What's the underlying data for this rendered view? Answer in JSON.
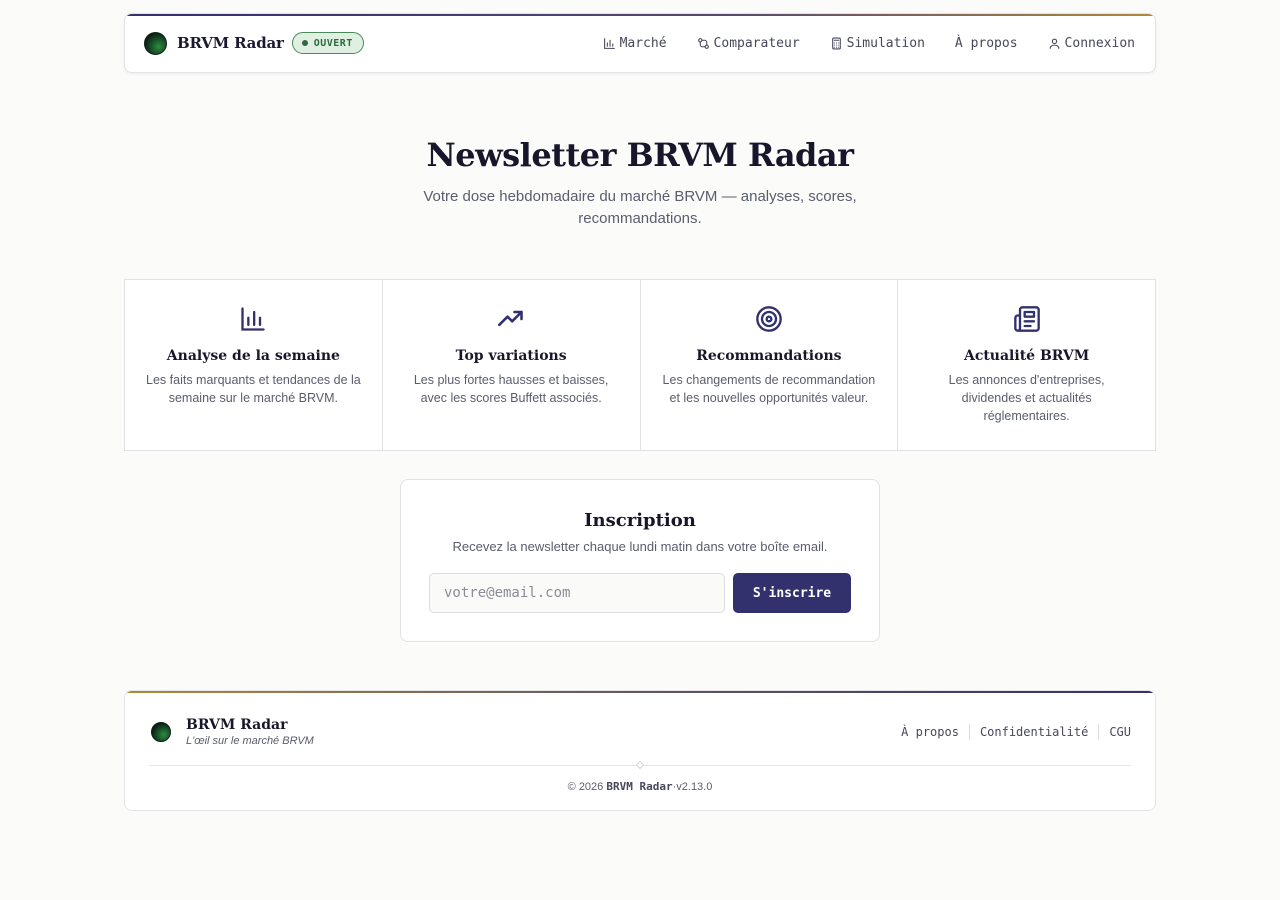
{
  "header": {
    "brand": "BRVM Radar",
    "status_badge": "OUVERT",
    "nav": {
      "market": "Marché",
      "compare": "Comparateur",
      "simulation": "Simulation",
      "about": "À propos",
      "login": "Connexion"
    }
  },
  "hero": {
    "title": "Newsletter BRVM Radar",
    "subtitle": "Votre dose hebdomadaire du marché BRVM — analyses, scores, recommandations."
  },
  "features": [
    {
      "icon": "bar-chart-icon",
      "title": "Analyse de la semaine",
      "desc": "Les faits marquants et tendances de la semaine sur le marché BRVM."
    },
    {
      "icon": "trending-up-icon",
      "title": "Top variations",
      "desc": "Les plus fortes hausses et baisses, avec les scores Buffett associés."
    },
    {
      "icon": "target-icon",
      "title": "Recommandations",
      "desc": "Les changements de recommandation et les nouvelles opportunités valeur."
    },
    {
      "icon": "newspaper-icon",
      "title": "Actualité BRVM",
      "desc": "Les annonces d'entreprises, dividendes et actualités réglementaires."
    }
  ],
  "signup": {
    "title": "Inscription",
    "subtitle": "Recevez la newsletter chaque lundi matin dans votre boîte email.",
    "email_placeholder": "votre@email.com",
    "email_value": "",
    "submit_label": "S'inscrire"
  },
  "footer": {
    "brand": "BRVM Radar",
    "tagline": "L'œil sur le marché BRVM",
    "links": {
      "about": "À propos",
      "privacy": "Confidentialité",
      "terms": "CGU"
    },
    "copyright_symbol": "©",
    "year": "2026",
    "copyright_brand": "BRVM Radar",
    "version": "v2.13.0"
  },
  "colors": {
    "accent": "#33306e",
    "open_badge": "#2d6a3c",
    "gold": "#b08a3a"
  }
}
